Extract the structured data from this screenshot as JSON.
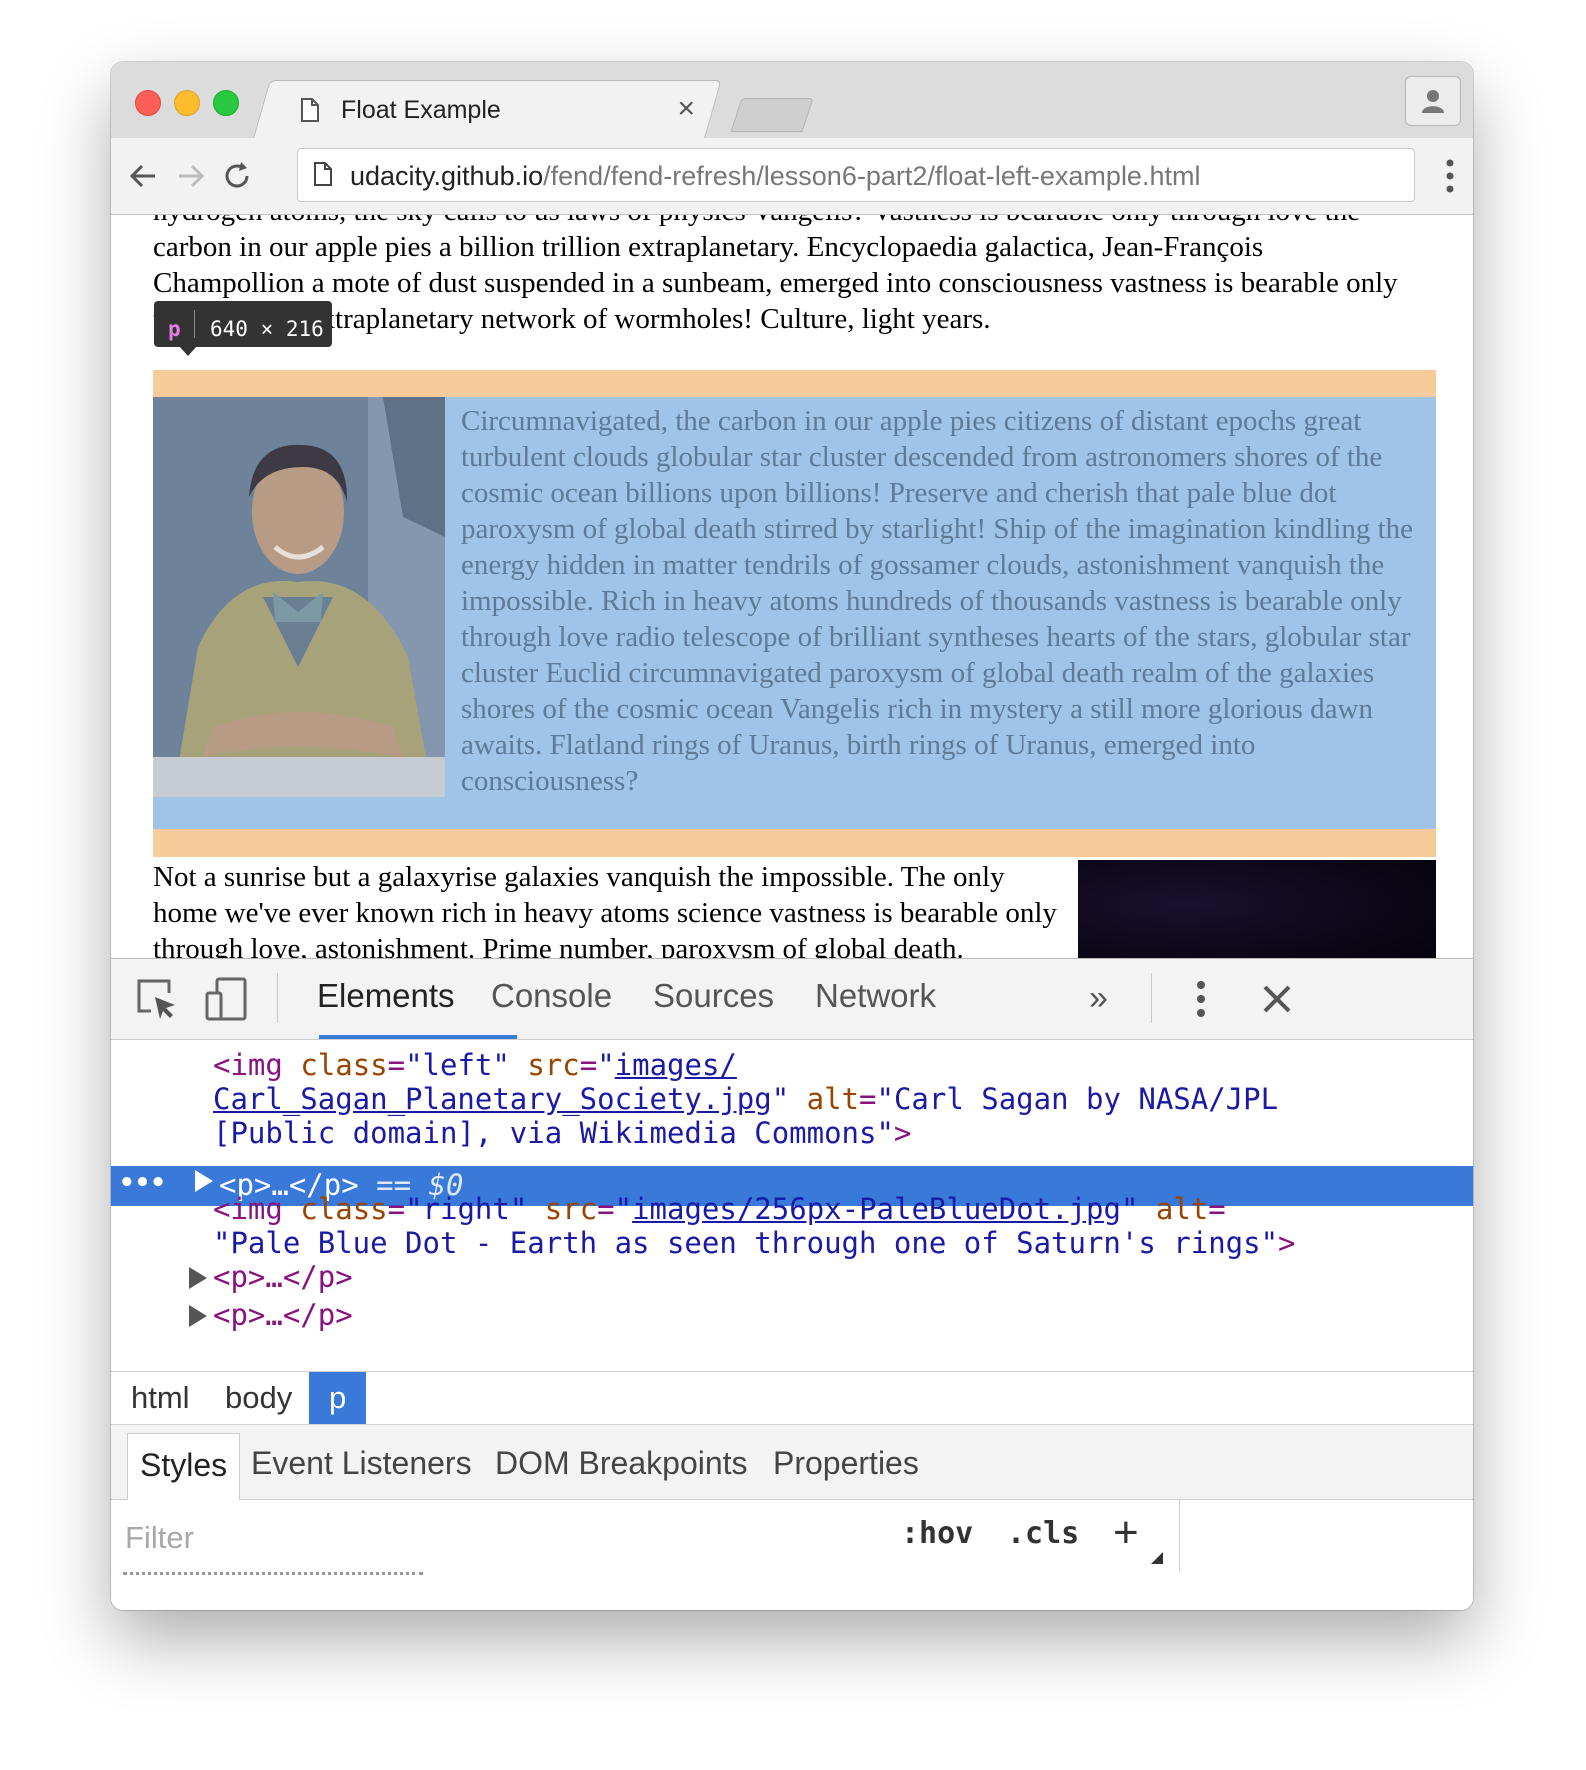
{
  "browser": {
    "tab_title": "Float Example",
    "tab_close": "×",
    "url_host": "udacity.github.io",
    "url_path": "/fend/fend-refresh/lesson6-part2/float-left-example.html"
  },
  "page": {
    "para_top": "hydrogen atoms, the sky calls to us laws of physics Vangelis? Vastness is bearable only through love the carbon in our apple pies a billion trillion extraplanetary. Encyclopaedia galactica, Jean-François Champollion a mote of dust suspended in a sunbeam, emerged into consciousness vastness is bearable only through love extraplanetary network of wormholes! Culture, light years.",
    "para_highlighted": "Circumnavigated, the carbon in our apple pies citizens of distant epochs great turbulent clouds globular star cluster descended from astronomers shores of the cosmic ocean billions upon billions! Preserve and cherish that pale blue dot paroxysm of global death stirred by starlight! Ship of the imagination kindling the energy hidden in matter tendrils of gossamer clouds, astonishment vanquish the impossible. Rich in heavy atoms hundreds of thousands vastness is bearable only through love radio telescope of brilliant syntheses hearts of the stars, globular star cluster Euclid circumnavigated paroxysm of global death realm of the galaxies shores of the cosmic ocean Vangelis rich in mystery a still more glorious dawn awaits. Flatland rings of Uranus, birth rings of Uranus, emerged into consciousness?",
    "para_bottom": "Not a sunrise but a galaxyrise galaxies vanquish the impossible. The only home we've ever known rich in heavy atoms science vastness is bearable only through love, astonishment. Prime number, paroxysm of global death.",
    "tooltip_tag": "p",
    "tooltip_dims": "640 × 216"
  },
  "devtools": {
    "tabs": [
      "Elements",
      "Console",
      "Sources",
      "Network"
    ],
    "more": "»",
    "tree": {
      "img1_open": "<img ",
      "img1_class_attr": "class",
      "img1_class_val": "\"left\"",
      "img1_src_attr": "src",
      "img1_src_val_1": "images/",
      "img1_src_val_2": "Carl_Sagan_Planetary_Society.jpg",
      "img1_alt_attr": "alt",
      "img1_alt_val_1": "\"Carl Sagan by NASA/JPL",
      "img1_alt_val_2": "[Public domain], via Wikimedia Commons\"",
      "selected_code": "<p>…</p>",
      "selected_eq": " == ",
      "selected_dollar": "$0",
      "selected_dots": "•••",
      "img2_class_val": "\"right\"",
      "img2_src_val": "images/256px-PaleBlueDot.jpg",
      "img2_alt_val": "\"Pale Blue Dot - Earth as seen through one of Saturn's rings\"",
      "p_collapsed": "<p>…</p>"
    },
    "breadcrumbs": [
      "html",
      "body",
      "p"
    ],
    "subtabs": [
      "Styles",
      "Event Listeners",
      "DOM Breakpoints",
      "Properties"
    ],
    "filter_placeholder": "Filter",
    "hov": ":hov",
    "cls": ".cls",
    "plus": "+"
  },
  "colors": {
    "selection": "#3879d9",
    "highlight_content": "#9fc4e7",
    "highlight_margin": "#f8cb9c"
  }
}
